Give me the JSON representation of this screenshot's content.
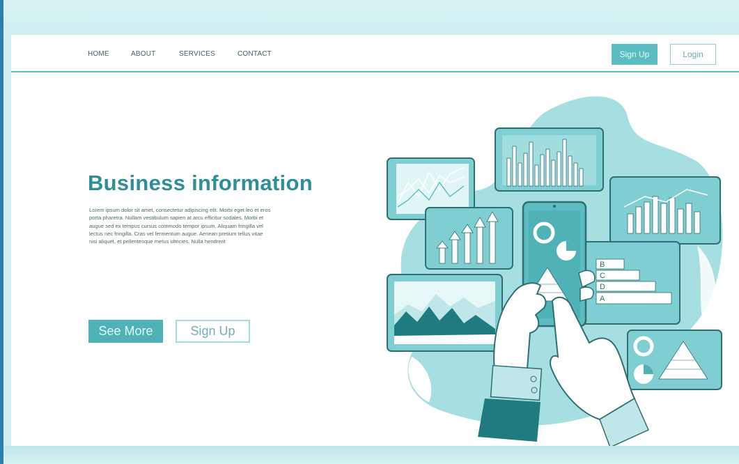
{
  "nav": {
    "links": [
      "HOME",
      "ABOUT",
      "SERVICES",
      "CONTACT"
    ],
    "signup_label": "Sign Up",
    "login_label": "Login"
  },
  "hero": {
    "title": "Business information",
    "body": "Lorem ipsum dolor sit amet, consectetur adipiscing elit. Morbi eget leo et eros porta pharetra. Nullam vestibulum sapien at arcu efficitur sodales. Morbi et augue sed ex tempus cursus commodo tempor ipsum. Aliquam fringilla vel lectus nec fringilla. Cras vel fermentum augue. Aenean pretium tellus vitae nisi aliquet, et pellentesque metus ultricies. Nulla hendrerit",
    "see_more_label": "See More",
    "signup_label": "Sign Up"
  },
  "illustration": {
    "staircase_letters": [
      "B",
      "C",
      "D",
      "A"
    ]
  },
  "colors": {
    "accent": "#5bbdc1",
    "title": "#2f8f97",
    "dark_teal": "#1e7c80",
    "panel_fill": "#7fcfd2",
    "blob": "#a5dfe1"
  }
}
